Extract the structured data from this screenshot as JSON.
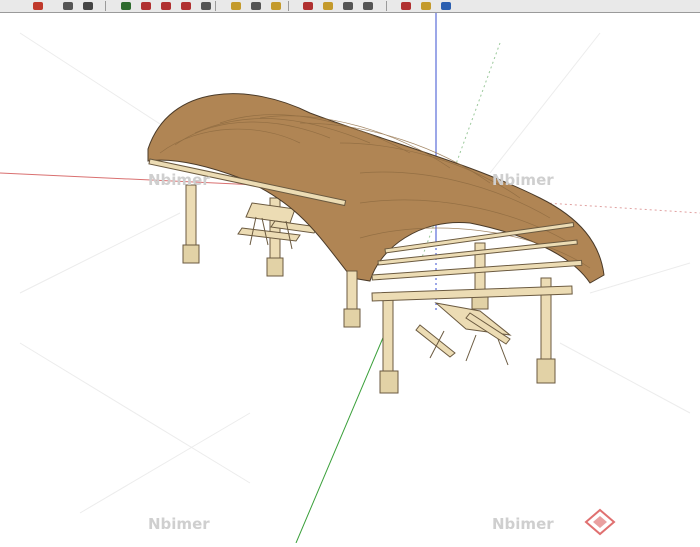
{
  "toolbar": {
    "buttons": [
      {
        "icon": "select-arrow-icon",
        "color": "#c0392b"
      },
      {
        "icon": "paint-bucket-icon",
        "color": "#555555"
      },
      {
        "icon": "eraser-icon",
        "color": "#444444"
      },
      {
        "icon": "make-component-icon",
        "color": "#2e6b2e"
      },
      {
        "icon": "push-pull-icon",
        "color": "#b03030"
      },
      {
        "icon": "move-icon",
        "color": "#b03030"
      },
      {
        "icon": "rotate-icon",
        "color": "#b03030"
      },
      {
        "icon": "scale-icon",
        "color": "#555555"
      },
      {
        "icon": "tape-measure-icon",
        "color": "#c49a2b"
      },
      {
        "icon": "dimension-icon",
        "color": "#555555"
      },
      {
        "icon": "protractor-icon",
        "color": "#c49a2b"
      },
      {
        "icon": "orbit-icon",
        "color": "#b03030"
      },
      {
        "icon": "pan-icon",
        "color": "#c49a2b"
      },
      {
        "icon": "zoom-icon",
        "color": "#555555"
      },
      {
        "icon": "zoom-window-icon",
        "color": "#555555"
      },
      {
        "icon": "previous-view-icon",
        "color": "#b03030"
      },
      {
        "icon": "section-plane-icon",
        "color": "#c49a2b"
      },
      {
        "icon": "walk-icon",
        "color": "#2b5fb0"
      }
    ]
  },
  "watermarks": {
    "text": "Nbimer",
    "color": "#cfcfcf"
  },
  "axes": {
    "red": "#d97070",
    "green": "#3aa03a",
    "blue": "#3a4fd0"
  },
  "model": {
    "roof_color": "#b08554",
    "timber_color": "#ecdcb4",
    "post_base_color": "#e2d2a6",
    "outline_color": "#4a3a28"
  }
}
